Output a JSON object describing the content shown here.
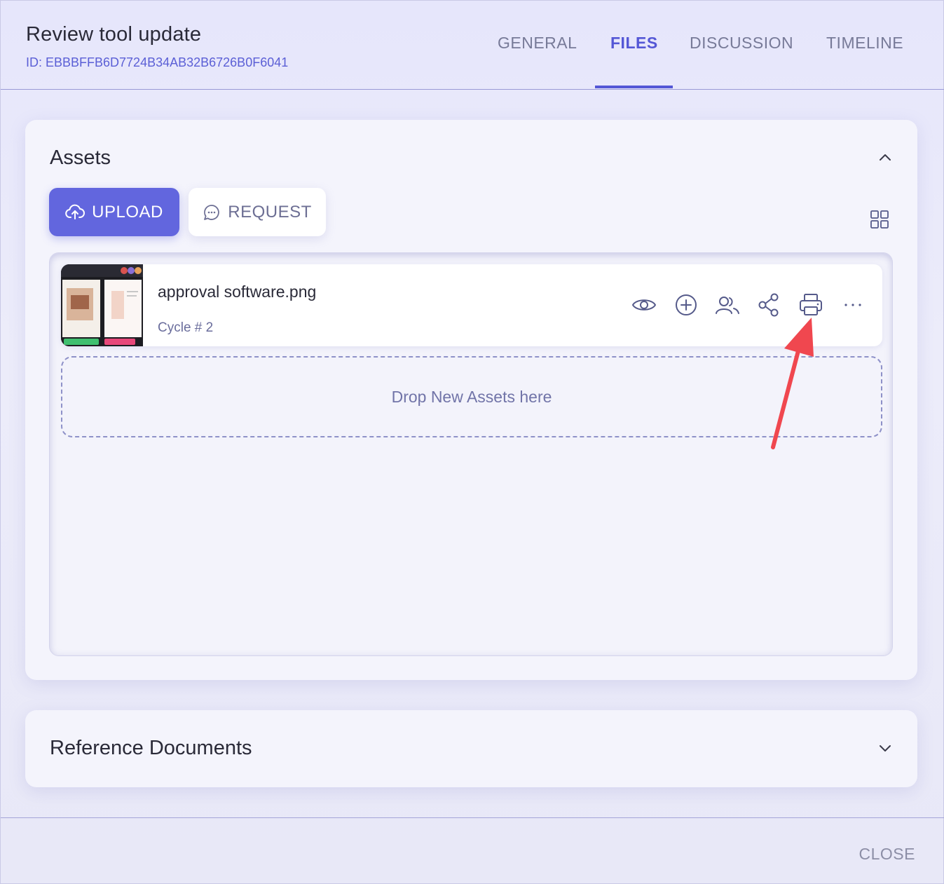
{
  "header": {
    "title": "Review tool update",
    "id_text": "ID: EBBBFFB6D7724B34AB32B6726B0F6041"
  },
  "tabs": [
    {
      "label": "GENERAL",
      "active": false
    },
    {
      "label": "FILES",
      "active": true
    },
    {
      "label": "DISCUSSION",
      "active": false
    },
    {
      "label": "TIMELINE",
      "active": false
    }
  ],
  "assets": {
    "title": "Assets",
    "upload_label": "UPLOAD",
    "request_label": "REQUEST",
    "items": [
      {
        "name": "approval software.png",
        "cycle": "Cycle # 2",
        "actions": [
          "eye-icon",
          "plus-circle-icon",
          "users-icon",
          "share-icon",
          "printer-icon",
          "more-icon"
        ]
      }
    ],
    "dropzone_text": "Drop New Assets here"
  },
  "reference": {
    "title": "Reference Documents"
  },
  "footer": {
    "close_label": "CLOSE"
  },
  "colors": {
    "accent": "#5457d6",
    "annotation_arrow": "#f0474f"
  }
}
